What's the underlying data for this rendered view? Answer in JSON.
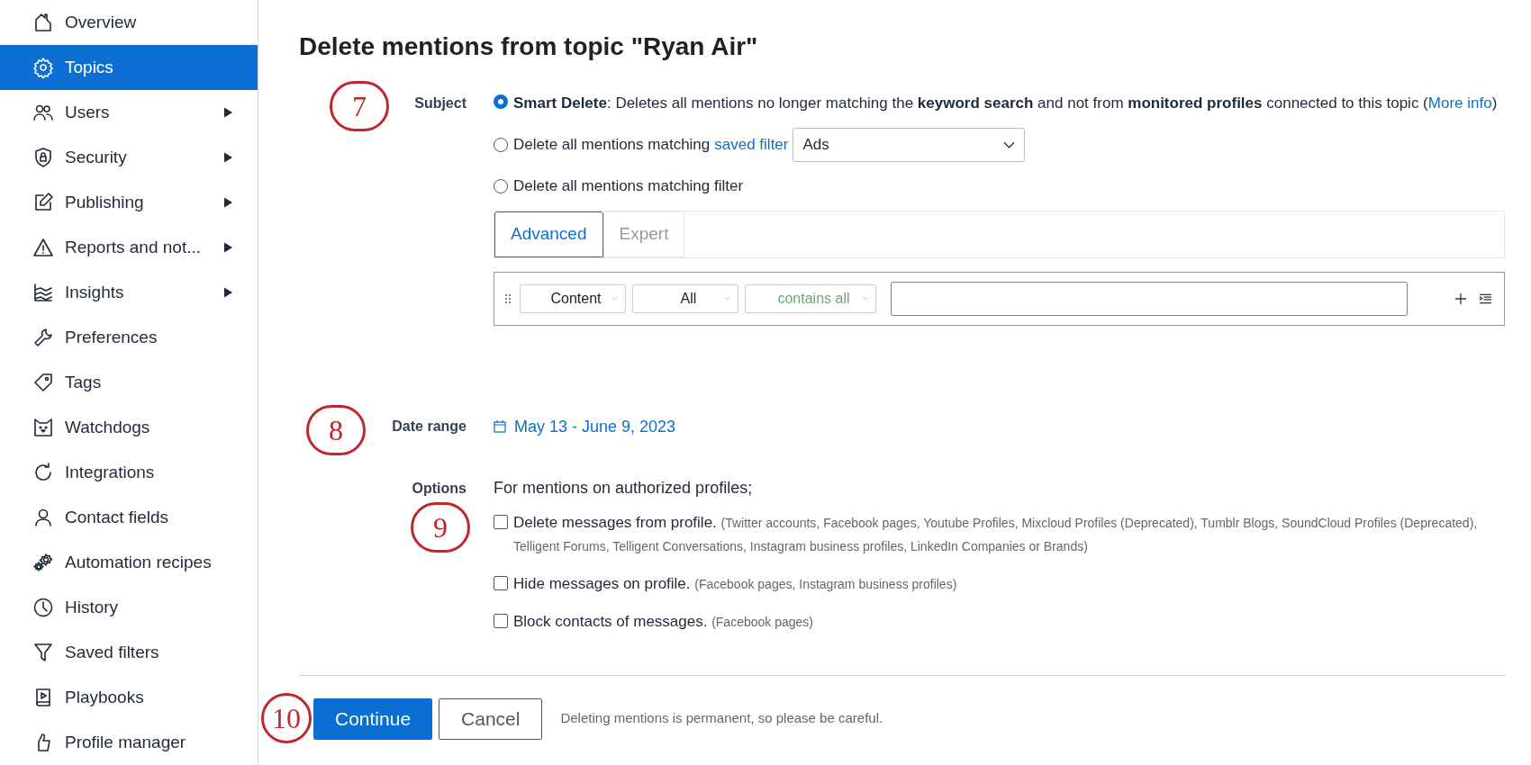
{
  "sidebar": {
    "items": [
      {
        "label": "Overview",
        "submenu": false,
        "selected": false
      },
      {
        "label": "Topics",
        "submenu": false,
        "selected": true
      },
      {
        "label": "Users",
        "submenu": true,
        "selected": false
      },
      {
        "label": "Security",
        "submenu": true,
        "selected": false
      },
      {
        "label": "Publishing",
        "submenu": true,
        "selected": false
      },
      {
        "label": "Reports and not...",
        "submenu": true,
        "selected": false
      },
      {
        "label": "Insights",
        "submenu": true,
        "selected": false
      },
      {
        "label": "Preferences",
        "submenu": false,
        "selected": false
      },
      {
        "label": "Tags",
        "submenu": false,
        "selected": false
      },
      {
        "label": "Watchdogs",
        "submenu": false,
        "selected": false
      },
      {
        "label": "Integrations",
        "submenu": false,
        "selected": false
      },
      {
        "label": "Contact fields",
        "submenu": false,
        "selected": false
      },
      {
        "label": "Automation recipes",
        "submenu": false,
        "selected": false
      },
      {
        "label": "History",
        "submenu": false,
        "selected": false
      },
      {
        "label": "Saved filters",
        "submenu": false,
        "selected": false
      },
      {
        "label": "Playbooks",
        "submenu": false,
        "selected": false
      },
      {
        "label": "Profile manager",
        "submenu": false,
        "selected": false
      }
    ]
  },
  "title": "Delete mentions from topic \"Ryan Air\"",
  "subject": {
    "label": "Subject",
    "options": [
      {
        "kind": "smart",
        "selected": true,
        "text": "**Smart Delete**: Deletes all mentions no longer matching the **keyword search** and not from **monitored profiles** connected to this topic (",
        "link": "More info",
        "text_after": ")"
      },
      {
        "kind": "saved_filter",
        "selected": false,
        "text": "Delete all mentions matching",
        "link": "saved filter",
        "select": "Ads"
      },
      {
        "kind": "filter",
        "selected": false,
        "text": "Delete all mentions matching filter"
      }
    ],
    "filter": {
      "tabs": [
        {
          "label": "Advanced",
          "selected": true
        },
        {
          "label": "Expert",
          "selected": false
        }
      ],
      "selects": [
        {
          "value": "Content",
          "kind": "normal"
        },
        {
          "value": "All",
          "kind": "normal"
        },
        {
          "value": "contains all",
          "kind": "operator"
        }
      ]
    }
  },
  "date_range": {
    "label": "Date range",
    "value": "May 13 - June 9, 2023"
  },
  "options": {
    "label": "Options",
    "intro": "For mentions on authorized profiles;",
    "checkboxes": [
      {
        "label": "Delete messages from profile.",
        "note": "(Twitter accounts, Facebook pages, Youtube Profiles, Mixcloud Profiles (Deprecated), Tumblr Blogs, SoundCloud Profiles (Deprecated), Telligent Forums, Telligent Conversations, Instagram business profiles, LinkedIn Companies or Brands)",
        "checked": false
      },
      {
        "label": "Hide messages on profile.",
        "note": "(Facebook pages, Instagram business profiles)",
        "checked": false
      },
      {
        "label": "Block contacts of messages.",
        "note": "(Facebook pages)",
        "checked": false
      }
    ]
  },
  "footer": {
    "primary": "Continue",
    "secondary": "Cancel",
    "note": "Deleting mentions is permanent, so please be careful."
  },
  "annotations": [
    {
      "label": "7"
    },
    {
      "label": "8"
    },
    {
      "label": "9"
    },
    {
      "label": "10"
    }
  ]
}
